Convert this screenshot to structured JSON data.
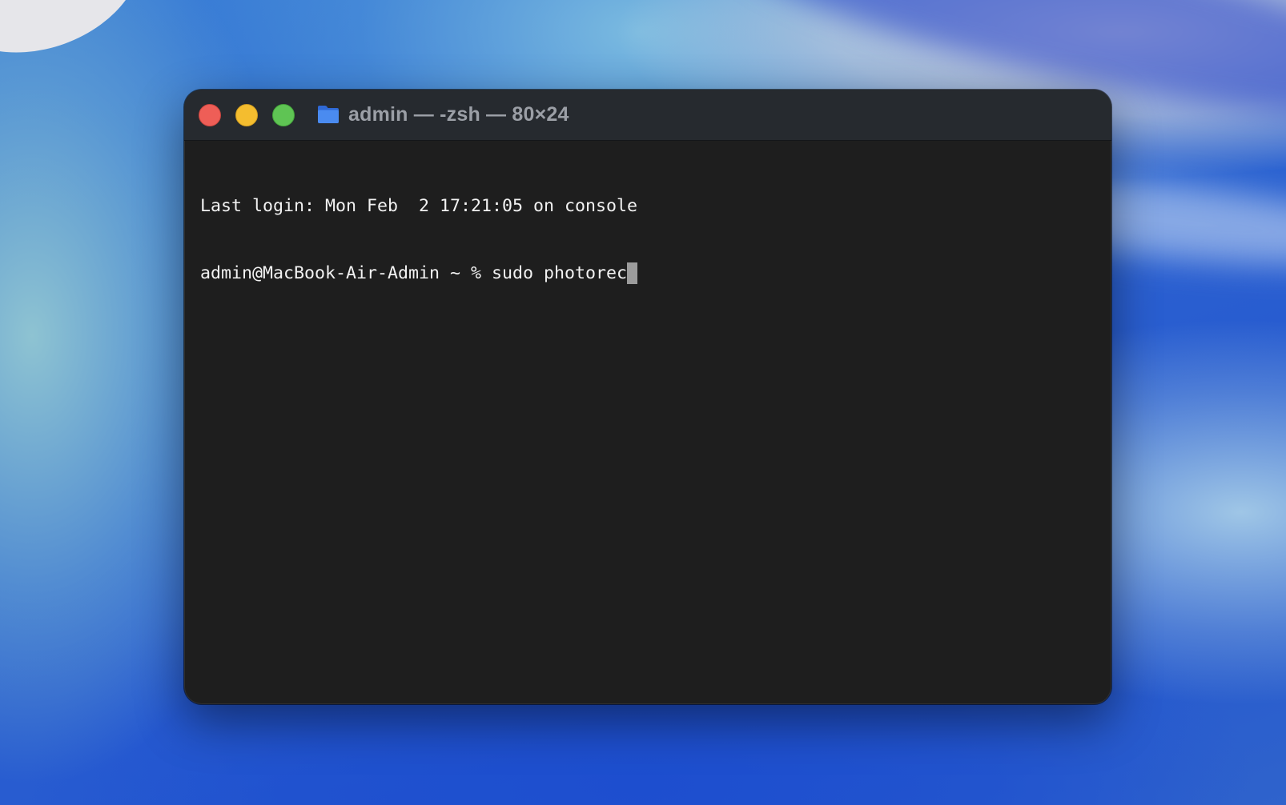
{
  "window": {
    "title": "admin — -zsh — 80×24",
    "title_icon": "folder-icon"
  },
  "terminal": {
    "lines": [
      "Last login: Mon Feb  2 17:21:05 on console",
      "admin@MacBook-Air-Admin ~ % sudo photorec"
    ]
  },
  "colors": {
    "close": "#ee5e57",
    "minimize": "#f4bd2f",
    "zoom": "#5fc454",
    "folder": "#3d7be6",
    "terminal_background": "#1e1e1e",
    "terminal_text": "#f2f2f2",
    "cursor": "#9c9c9c"
  }
}
